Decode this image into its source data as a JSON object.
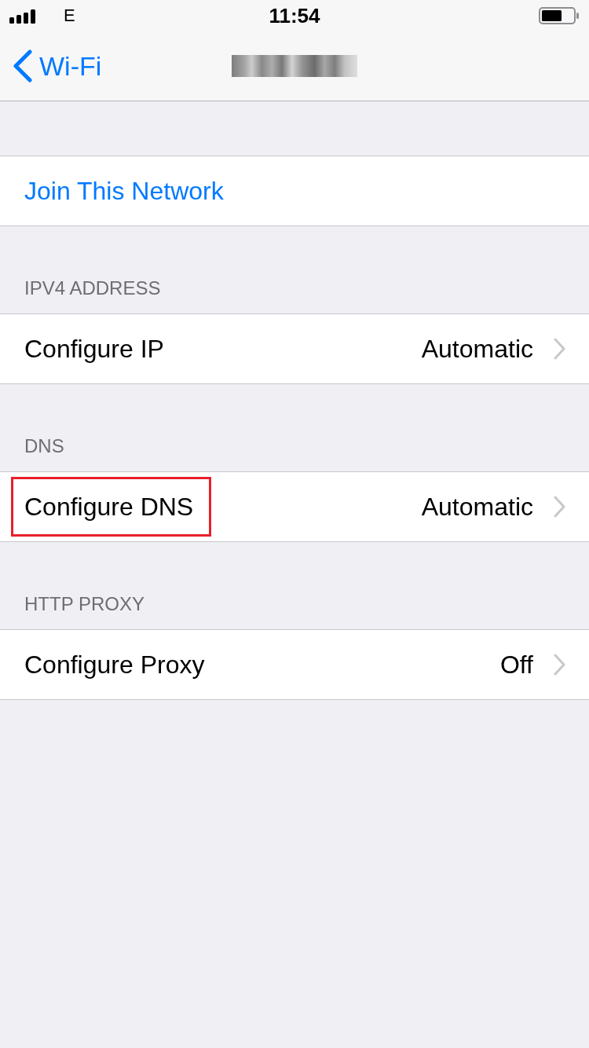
{
  "status_bar": {
    "carrier": "E",
    "time": "11:54"
  },
  "nav_bar": {
    "back_label": "Wi-Fi"
  },
  "join_button": {
    "label": "Join This Network"
  },
  "sections": [
    {
      "header": "IPV4 ADDRESS",
      "rows": [
        {
          "label": "Configure IP",
          "value": "Automatic",
          "highlighted": false
        }
      ]
    },
    {
      "header": "DNS",
      "rows": [
        {
          "label": "Configure DNS",
          "value": "Automatic",
          "highlighted": true
        }
      ]
    },
    {
      "header": "HTTP PROXY",
      "rows": [
        {
          "label": "Configure Proxy",
          "value": "Off",
          "highlighted": false
        }
      ]
    }
  ]
}
